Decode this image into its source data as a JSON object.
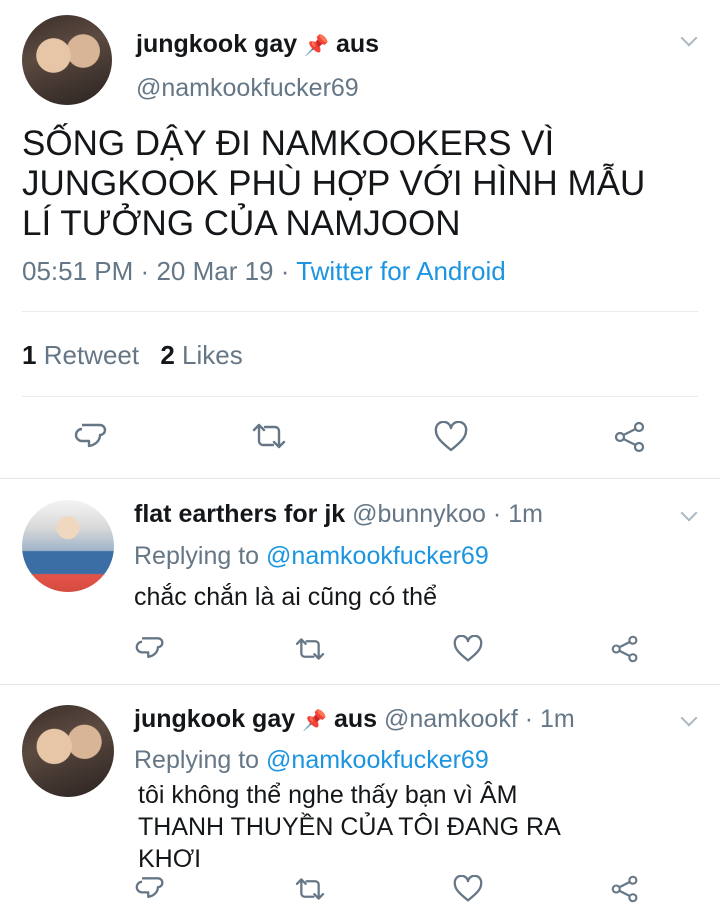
{
  "main_tweet": {
    "display_name": "jungkook gay",
    "pin_emoji": "📌",
    "display_name_suffix": "aus",
    "handle": "@namkookfucker69",
    "text_lines": [
      "SỐNG DẬY ĐI NAMKOOKERS VÌ",
      "JUNGKOOK PHÙ HỢP VỚI HÌNH MẪU",
      "LÍ TƯỞNG CỦA NAMJOON"
    ],
    "time": "05:51 PM",
    "date": "20 Mar 19",
    "source": "Twitter for Android",
    "retweet_count": "1",
    "retweet_label": "Retweet",
    "like_count": "2",
    "like_label": "Likes"
  },
  "replies": [
    {
      "display_name": "flat earthers for jk",
      "handle": "@bunnykoo",
      "time": "1m",
      "replying_prefix": "Replying to",
      "replying_to": "@namkookfucker69",
      "text": "chắc chắn là ai cũng có thể"
    },
    {
      "display_name": "jungkook gay",
      "pin_emoji": "📌",
      "display_name_suffix": "aus",
      "handle": "@namkookf",
      "time": "1m",
      "replying_prefix": "Replying to",
      "replying_to": "@namkookfucker69",
      "text_lines": [
        "tôi không thể nghe thấy bạn vì ÂM",
        "THANH THUYỀN CỦA TÔI ĐANG RA",
        "KHƠI"
      ]
    }
  ],
  "separator": "·",
  "colors": {
    "text": "#14171a",
    "muted": "#657786",
    "link": "#1b95e0",
    "divider": "#e1e8ed"
  },
  "icons": [
    "reply-icon",
    "retweet-icon",
    "like-icon",
    "share-icon",
    "chevron-down-icon"
  ]
}
